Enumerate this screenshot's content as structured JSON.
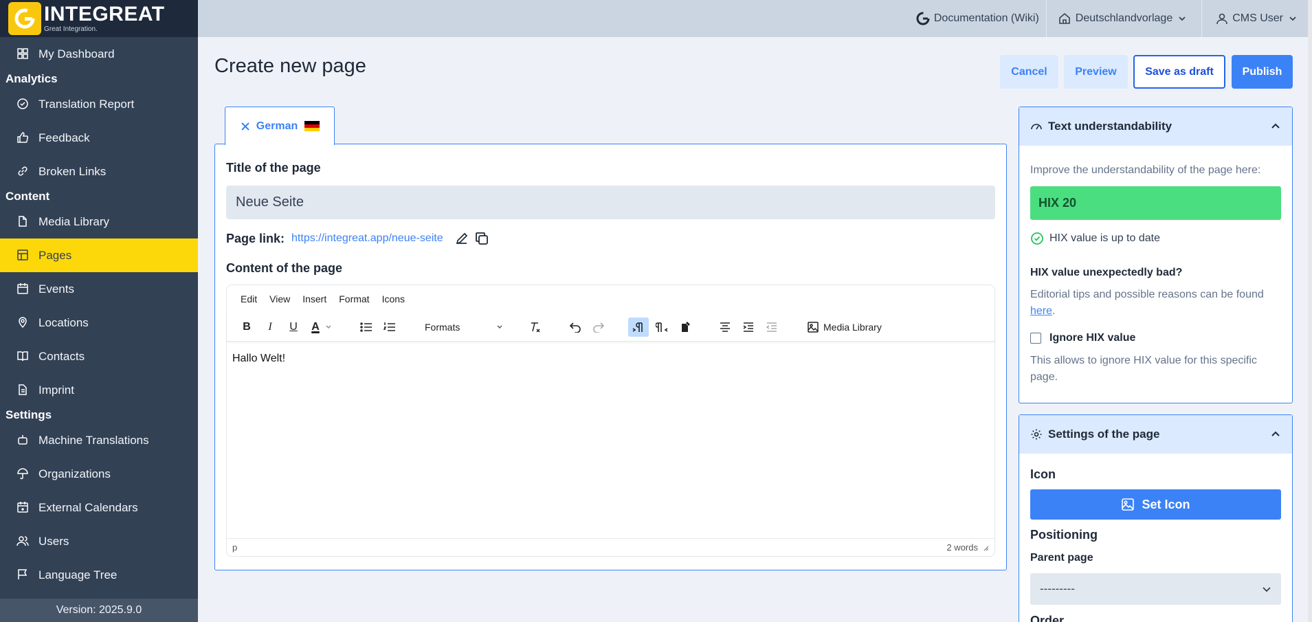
{
  "sidebar": {
    "logo_name": "INTEGREAT",
    "logo_sub": "Great Integration.",
    "items": [
      {
        "label": "My Dashboard"
      },
      {
        "section": "Analytics"
      },
      {
        "label": "Translation Report"
      },
      {
        "label": "Feedback"
      },
      {
        "label": "Broken Links"
      },
      {
        "section": "Content"
      },
      {
        "label": "Media Library"
      },
      {
        "label": "Pages"
      },
      {
        "label": "Events"
      },
      {
        "label": "Locations"
      },
      {
        "label": "Contacts"
      },
      {
        "label": "Imprint"
      },
      {
        "section": "Settings"
      },
      {
        "label": "Machine Translations"
      },
      {
        "label": "Organizations"
      },
      {
        "label": "External Calendars"
      },
      {
        "label": "Users"
      },
      {
        "label": "Language Tree"
      }
    ],
    "version": "Version: 2025.9.0"
  },
  "topbar": {
    "docs": "Documentation (Wiki)",
    "region": "Deutschlandvorlage",
    "user": "CMS User"
  },
  "main": {
    "title": "Create new page",
    "buttons": {
      "cancel": "Cancel",
      "preview": "Preview",
      "draft": "Save as draft",
      "publish": "Publish"
    },
    "tab_label": "German",
    "title_label": "Title of the page",
    "title_value": "Neue Seite",
    "link_label": "Page link:",
    "link_url": "https://integreat.app/neue-seite",
    "content_label": "Content of the page",
    "editor": {
      "menu": [
        "Edit",
        "View",
        "Insert",
        "Format",
        "Icons"
      ],
      "formats": "Formats",
      "media_library": "Media Library",
      "body": "Hallo Welt!",
      "path": "p",
      "word_count": "2 words"
    }
  },
  "understandability": {
    "heading": "Text understandability",
    "intro": "Improve the understandability of the page here:",
    "hix": "HIX 20",
    "hix_status": "HIX value is up to date",
    "bad_heading": "HIX value unexpectedly bad?",
    "bad_text": "Editorial tips and possible reasons can be found",
    "bad_link": "here",
    "ignore_label": "Ignore HIX value",
    "ignore_help": "This allows to ignore HIX value for this specific page."
  },
  "settings": {
    "heading": "Settings of the page",
    "icon_label": "Icon",
    "set_icon": "Set Icon",
    "positioning": "Positioning",
    "parent_label": "Parent page",
    "parent_value": "---------",
    "order_label": "Order"
  },
  "colors": {
    "sidebar": "#334155",
    "active": "#fcd80b",
    "accent": "#3b82f6",
    "hix_good": "#4ade80"
  }
}
